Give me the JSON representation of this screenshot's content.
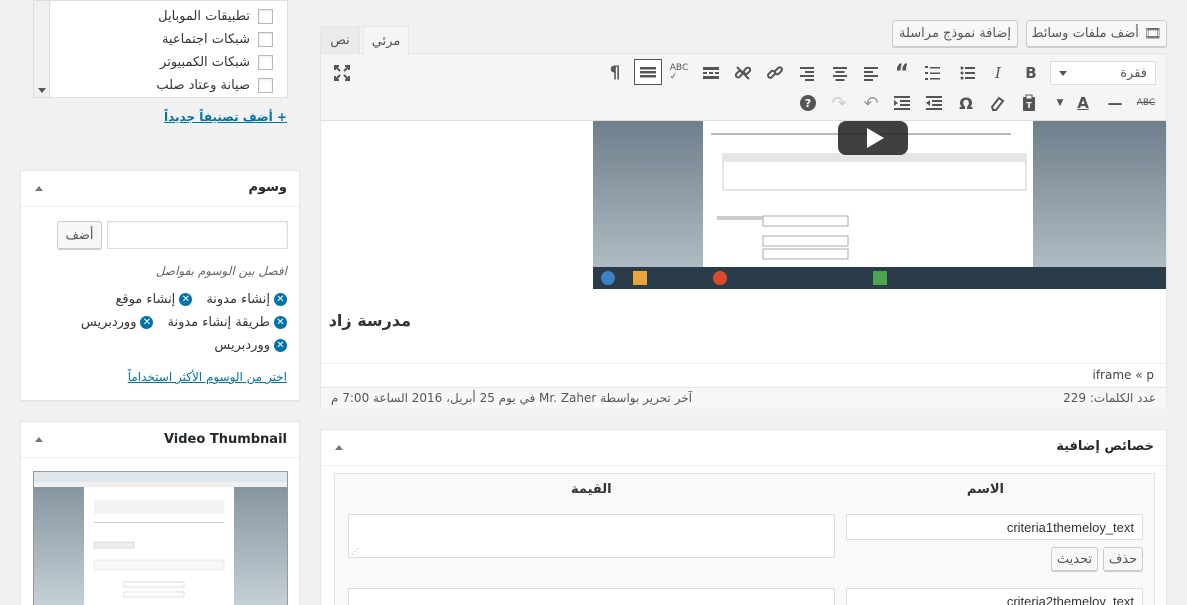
{
  "categories": {
    "items": [
      "تطبيقات الموبايل",
      "شبكات اجتماعية",
      "شبكات الكمبيوتر",
      "صيانة وعتاد صلب"
    ],
    "add_link": "+ أضف تصنيفاً جديداً"
  },
  "tags": {
    "title": "وسوم",
    "add_button": "أضف",
    "input_value": "",
    "hint": "افصل بين الوسوم بفواصل",
    "items": [
      "إنشاء مدونة",
      "إنشاء موقع",
      "طريقة إنشاء مدونة",
      "ووردبريس",
      "ووردبريس"
    ],
    "most_used_link": "اختر من الوسوم الأكثر استخداماً"
  },
  "video_thumbnail": {
    "title": "Video Thumbnail"
  },
  "editor": {
    "add_media": "أضف ملفات وسائط",
    "add_form": "إضافة نموذج مراسلة",
    "tab_visual": "مرئي",
    "tab_text": "نص",
    "format_select": "فقرة",
    "heading": "مدرسة زاد",
    "path": "iframe « p",
    "word_count": "عدد الكلمات: 229",
    "last_edit": "آخر تحرير بواسطة Mr. Zaher في يوم 25 أبريل، 2016 الساعة 7:00 م"
  },
  "custom_fields": {
    "title": "خصائص إضافية",
    "col_name": "الاسم",
    "col_value": "القيمة",
    "rows": [
      {
        "key": "criteria1themeloy_text",
        "value": ""
      },
      {
        "key": "criteria2themeloy_text",
        "value": ""
      }
    ],
    "delete_button": "حذف",
    "update_button": "تحديث"
  },
  "colors": {
    "link": "#0073aa",
    "background": "#f1f1f1"
  }
}
